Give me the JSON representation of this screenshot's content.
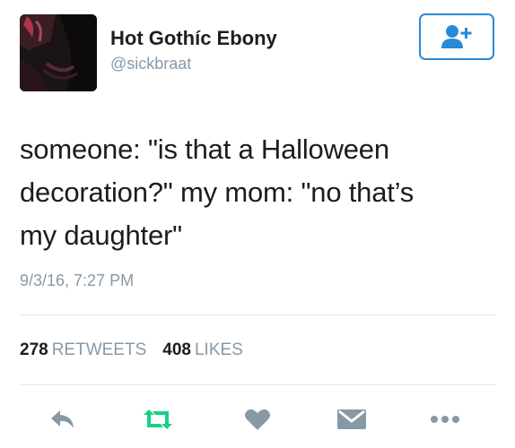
{
  "user": {
    "display_name": "Hot Gothíc Ebony",
    "username": "@sickbraat"
  },
  "follow_button_icon": "add-user-icon",
  "tweet": {
    "lines": [
      "someone: \"is that a Halloween",
      "decoration?\"  my mom: \"no that’s",
      "my daughter\""
    ],
    "timestamp": "9/3/16, 7:27 PM"
  },
  "stats": {
    "retweets_count": "278",
    "retweets_label": "RETWEETS",
    "likes_count": "408",
    "likes_label": "LIKES"
  },
  "actions": [
    "reply-icon",
    "retweet-icon",
    "like-icon",
    "direct-message-icon",
    "more-icon"
  ],
  "colors": {
    "accent": "#2b8ad6",
    "retweet": "#19cf86",
    "muted": "#8899a6",
    "divider": "#e1e8ed"
  }
}
